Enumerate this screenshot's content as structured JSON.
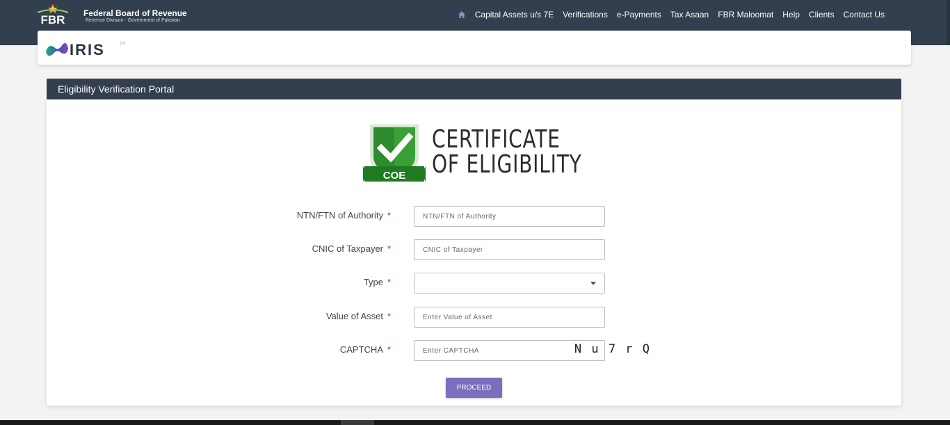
{
  "header": {
    "org_name": "Federal Board of Revenue",
    "org_sub": "Revenue Division - Government of Pakistan",
    "logo_text": "FBR",
    "nav": [
      {
        "label": "Capital Assets u/s 7E"
      },
      {
        "label": "Verifications"
      },
      {
        "label": "e-Payments"
      },
      {
        "label": "Tax Asaan"
      },
      {
        "label": "FBR Maloomat"
      },
      {
        "label": "Help"
      },
      {
        "label": "Clients"
      },
      {
        "label": "Contact Us"
      }
    ],
    "home_icon": "home-icon"
  },
  "iris": {
    "logo_text": "IRIS",
    "version": "2.0"
  },
  "panel": {
    "title": "Eligibility Verification Portal"
  },
  "coe": {
    "badge_text": "COE",
    "title_line1": "CERTIFICATE",
    "title_line2": "OF ELIGIBILITY"
  },
  "form": {
    "ntn": {
      "label": "NTN/FTN of Authority",
      "placeholder": "NTN/FTN of Authority",
      "value": ""
    },
    "cnic": {
      "label": "CNIC of Taxpayer",
      "placeholder": "CNIC of Taxpayer",
      "value": ""
    },
    "type": {
      "label": "Type",
      "value": ""
    },
    "asset": {
      "label": "Value of Asset",
      "placeholder": "Enter Value of Asset",
      "value": ""
    },
    "captcha": {
      "label": "CAPTCHA",
      "placeholder": "Enter CAPTCHA",
      "value": "",
      "image_text": "N u 7 r Q"
    },
    "required_mark": "*",
    "submit_label": "PROCEED"
  },
  "colors": {
    "header_bg": "#333e4f",
    "accent": "#7b6fbd",
    "badge_green": "#2e8b2e",
    "required": "#d01d1d"
  }
}
